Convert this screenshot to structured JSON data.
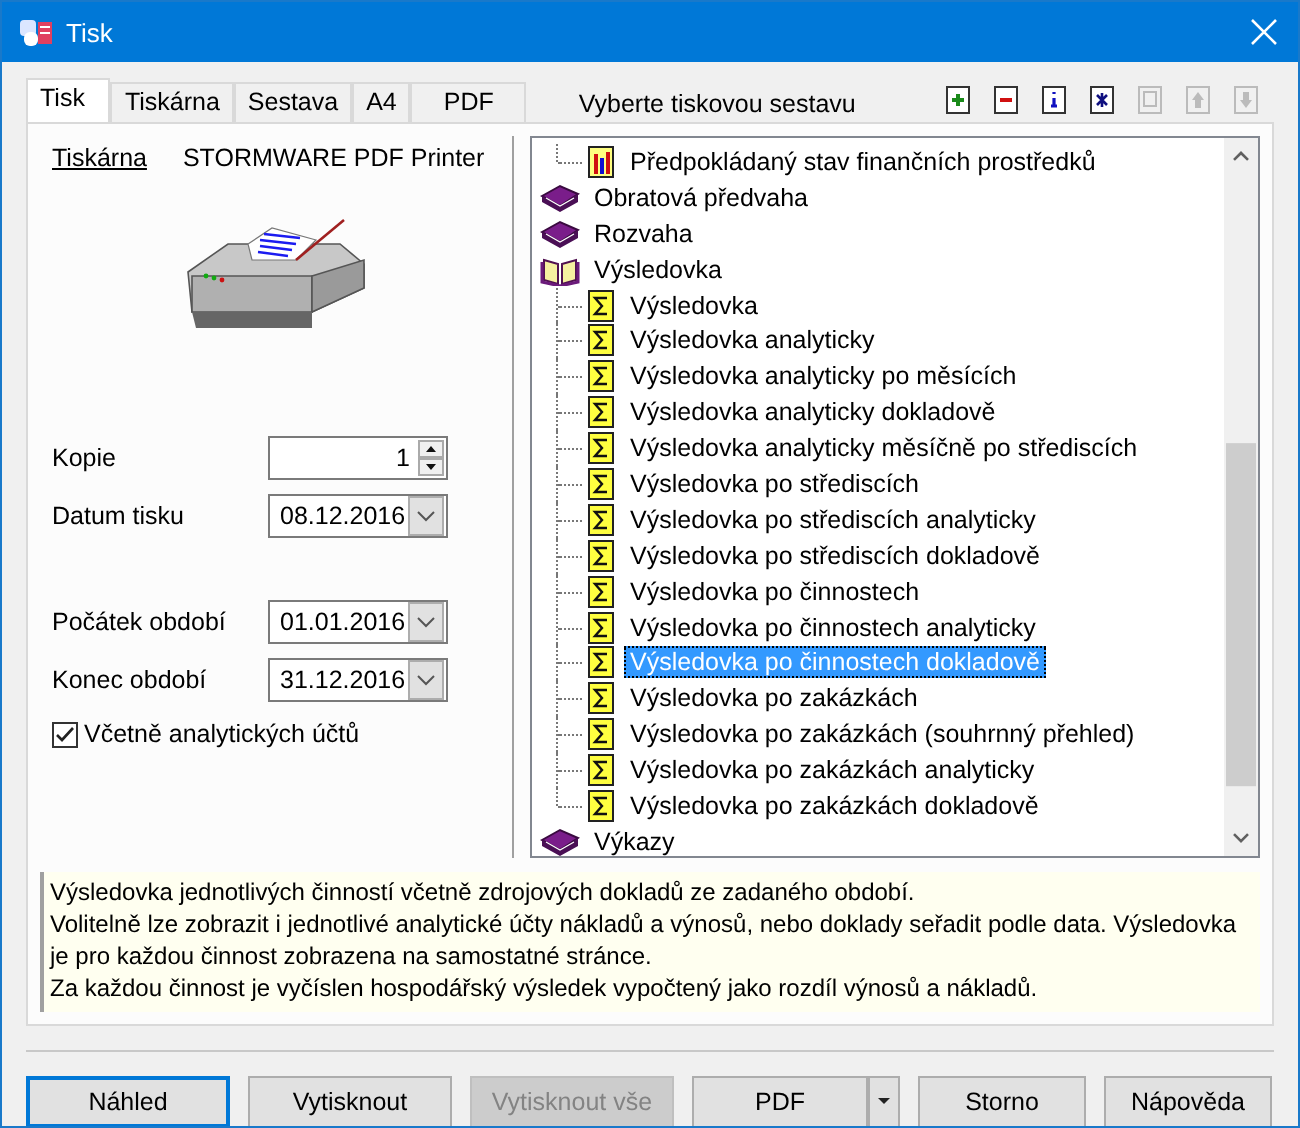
{
  "window": {
    "title": "Tisk"
  },
  "tabs": [
    {
      "label": "Tisk",
      "selected": true
    },
    {
      "label": "Tiskárna",
      "selected": false
    },
    {
      "label": "Sestava",
      "selected": false
    },
    {
      "label": "A4",
      "selected": false
    },
    {
      "label": "PDF",
      "selected": false
    }
  ],
  "report_picker_label": "Vyberte tiskovou sestavu",
  "toolbar": [
    {
      "kind": "add",
      "disabled": false
    },
    {
      "kind": "remove",
      "disabled": false
    },
    {
      "kind": "info",
      "disabled": false
    },
    {
      "kind": "star",
      "disabled": false
    },
    {
      "kind": "copy",
      "disabled": true
    },
    {
      "kind": "up",
      "disabled": true
    },
    {
      "kind": "down",
      "disabled": true
    }
  ],
  "printer": {
    "label": "Tiskárna",
    "name": "STORMWARE PDF Printer"
  },
  "fields": [
    {
      "kind": "spin",
      "label": "Kopie",
      "value": "1"
    },
    {
      "kind": "date",
      "label": "Datum tisku",
      "value": "08.12.2016"
    },
    {
      "kind": "date",
      "label": "Počátek období",
      "value": "01.01.2016"
    },
    {
      "kind": "date",
      "label": "Konec období",
      "value": "31.12.2016"
    }
  ],
  "include_analytic": {
    "label": "Včetně analytických účtů",
    "checked": true
  },
  "tree": {
    "continued_children": [
      {
        "label": "Předpokládaný stav finančních prostředků",
        "kind": "chart",
        "selected": false
      }
    ],
    "items": [
      {
        "label": "Obratová předvaha",
        "expanded": false
      },
      {
        "label": "Rozvaha",
        "expanded": false
      },
      {
        "label": "Výsledovka",
        "expanded": true,
        "children": [
          {
            "label": "Výsledovka",
            "kind": "sigma",
            "selected": false
          },
          {
            "label": "Výsledovka analyticky",
            "kind": "sigma",
            "selected": false
          },
          {
            "label": "Výsledovka analyticky po měsících",
            "kind": "sigma",
            "selected": false
          },
          {
            "label": "Výsledovka analyticky dokladově",
            "kind": "sigma",
            "selected": false
          },
          {
            "label": "Výsledovka analyticky měsíčně po střediscích",
            "kind": "sigma",
            "selected": false
          },
          {
            "label": "Výsledovka po střediscích",
            "kind": "sigma",
            "selected": false
          },
          {
            "label": "Výsledovka po střediscích analyticky",
            "kind": "sigma",
            "selected": false
          },
          {
            "label": "Výsledovka po střediscích dokladově",
            "kind": "sigma",
            "selected": false
          },
          {
            "label": "Výsledovka po činnostech",
            "kind": "sigma",
            "selected": false
          },
          {
            "label": "Výsledovka po činnostech analyticky",
            "kind": "sigma",
            "selected": false
          },
          {
            "label": "Výsledovka po činnostech dokladově",
            "kind": "sigma",
            "selected": true
          },
          {
            "label": "Výsledovka po zakázkách",
            "kind": "sigma",
            "selected": false
          },
          {
            "label": "Výsledovka po zakázkách (souhrnný přehled)",
            "kind": "sigma",
            "selected": false
          },
          {
            "label": "Výsledovka po zakázkách analyticky",
            "kind": "sigma",
            "selected": false
          },
          {
            "label": "Výsledovka po zakázkách dokladově",
            "kind": "sigma",
            "selected": false
          }
        ]
      },
      {
        "label": "Výkazy",
        "expanded": false
      }
    ]
  },
  "description": [
    "Výsledovka jednotlivých činností včetně zdrojových dokladů ze zadaného období.",
    "Volitelně lze zobrazit i jednotlivé analytické účty nákladů a výnosů, nebo doklady seřadit podle data. Výsledovka je pro každou činnost zobrazena na samostatné stránce.",
    "Za každou činnost je vyčíslen hospodářský výsledek vypočtený jako rozdíl výnosů a nákladů."
  ],
  "buttons": [
    {
      "label": "Náhled",
      "kind": "default",
      "disabled": false
    },
    {
      "label": "Vytisknout",
      "kind": "plain",
      "disabled": false
    },
    {
      "label": "Vytisknout vše",
      "kind": "plain",
      "disabled": true
    },
    {
      "label": "PDF",
      "kind": "split",
      "disabled": false
    },
    {
      "label": "Storno",
      "kind": "plain",
      "disabled": false
    },
    {
      "label": "Nápověda",
      "kind": "plain",
      "disabled": false
    }
  ]
}
